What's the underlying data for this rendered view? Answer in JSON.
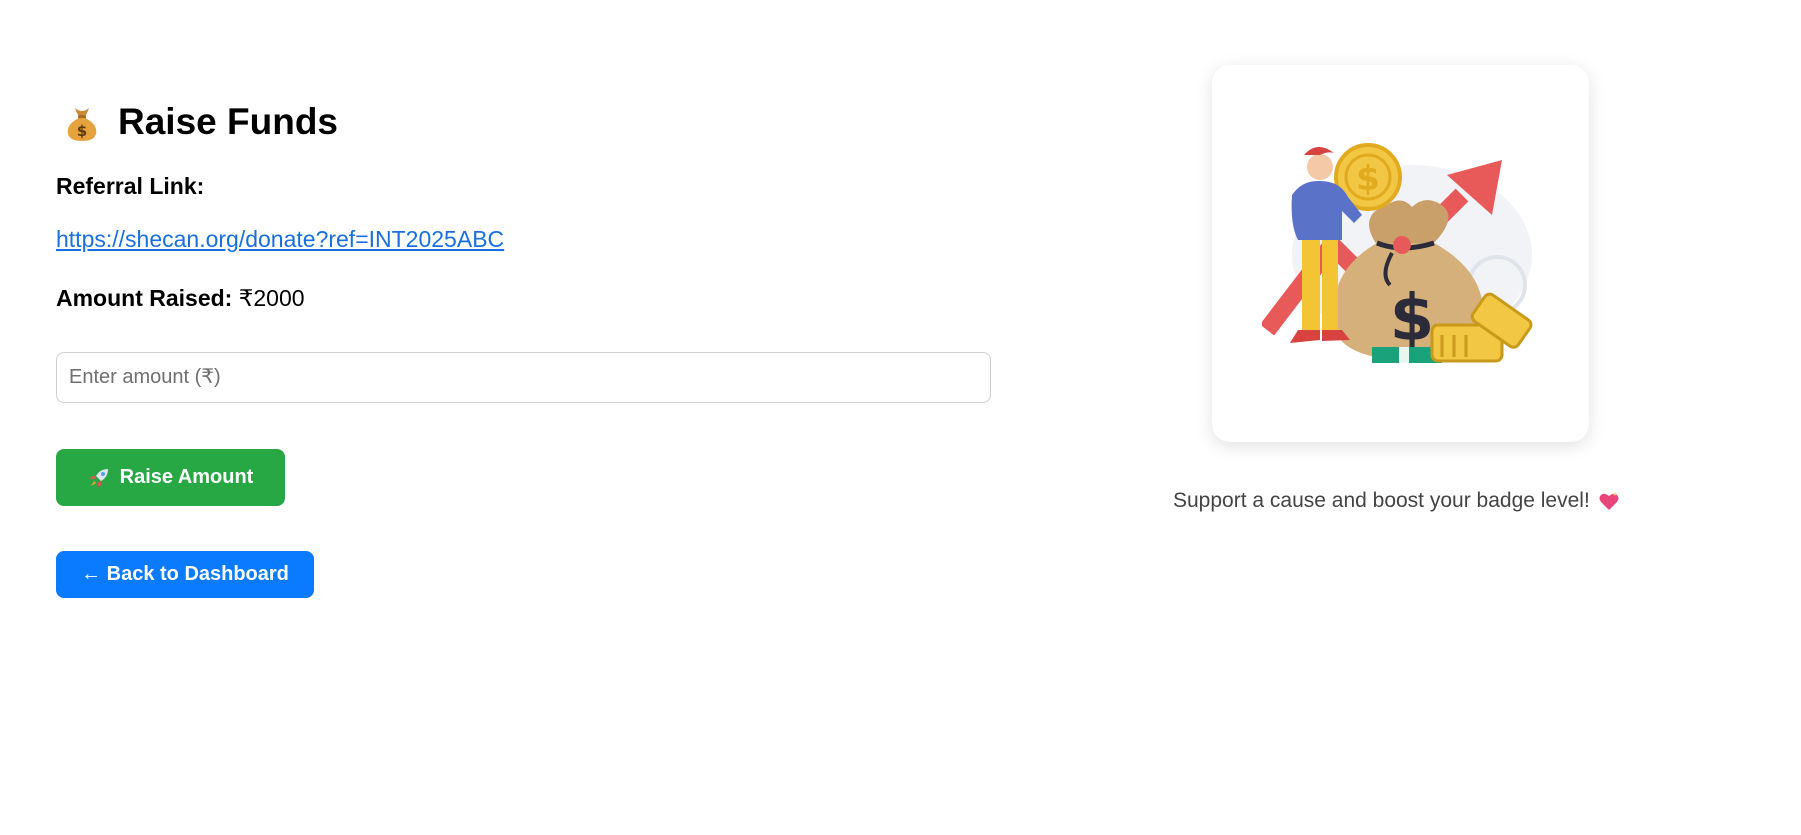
{
  "header": {
    "icon": "money-bag-icon",
    "title": "Raise Funds"
  },
  "referral": {
    "label": "Referral Link:",
    "url": "https://shecan.org/donate?ref=INT2025ABC"
  },
  "raised": {
    "label": "Amount Raised:",
    "value": "₹2000"
  },
  "amount_input": {
    "placeholder": "Enter amount (₹)",
    "value": ""
  },
  "buttons": {
    "raise_icon": "rocket-icon",
    "raise_label": "Raise Amount",
    "back_label": "← Back to Dashboard"
  },
  "side": {
    "illustration": "money-bag-growth-illustration",
    "tagline": "Support a cause and boost your badge level!",
    "tagline_icon": "sparkling-heart-icon"
  },
  "colors": {
    "link": "#1a6fe0",
    "raise_button": "#28a745",
    "back_button": "#0a7bff"
  }
}
